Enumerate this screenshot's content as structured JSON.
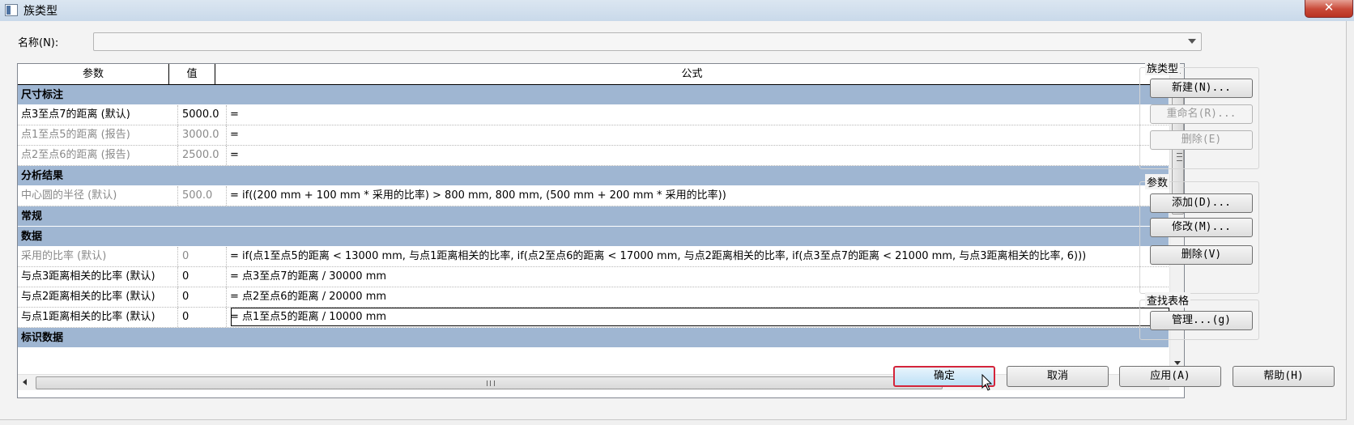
{
  "window": {
    "title": "族类型",
    "close_glyph": "✕"
  },
  "name_field": {
    "label": "名称(N):",
    "value": ""
  },
  "table": {
    "headers": [
      "参数",
      "值",
      "公式"
    ],
    "rows": [
      {
        "type": "group",
        "label": "尺寸标注"
      },
      {
        "type": "param",
        "name": "点3至点7的距离 (默认)",
        "value": "5000.0",
        "formula": "=",
        "dim": false
      },
      {
        "type": "param",
        "name": "点1至点5的距离 (报告)",
        "value": "3000.0",
        "formula": "=",
        "dim": true
      },
      {
        "type": "param",
        "name": "点2至点6的距离 (报告)",
        "value": "2500.0",
        "formula": "=",
        "dim": true
      },
      {
        "type": "group",
        "label": "分析结果"
      },
      {
        "type": "param",
        "name": "中心圆的半径 (默认)",
        "value": "500.0",
        "formula": "= if((200 mm + 100 mm * 采用的比率) > 800 mm, 800 mm, (500 mm + 200 mm * 采用的比率))",
        "dim": true
      },
      {
        "type": "group",
        "label": "常规"
      },
      {
        "type": "group",
        "label": "数据"
      },
      {
        "type": "param",
        "name": "采用的比率 (默认)",
        "value": "0",
        "formula": "= if(点1至点5的距离 < 13000 mm, 与点1距离相关的比率, if(点2至点6的距离 < 17000 mm, 与点2距离相关的比率, if(点3至点7的距离 < 21000 mm, 与点3距离相关的比率, 6)))",
        "dim": true
      },
      {
        "type": "param",
        "name": "与点3距离相关的比率 (默认)",
        "value": "0",
        "formula": "= 点3至点7的距离 / 30000 mm",
        "dim": false
      },
      {
        "type": "param",
        "name": "与点2距离相关的比率 (默认)",
        "value": "0",
        "formula": "= 点2至点6的距离 / 20000 mm",
        "dim": false
      },
      {
        "type": "param",
        "name": "与点1距离相关的比率 (默认)",
        "value": "0",
        "formula": "= 点1至点5的距离 / 10000 mm",
        "dim": false,
        "editing": true
      },
      {
        "type": "group",
        "label": "标识数据"
      }
    ]
  },
  "scrollbars": {
    "h_grip": "III"
  },
  "sidebar": {
    "family_types": {
      "title": "族类型",
      "new": "新建(N)...",
      "rename": "重命名(R)...",
      "delete": "删除(E)"
    },
    "parameters": {
      "title": "参数",
      "add": "添加(D)...",
      "modify": "修改(M)...",
      "delete": "删除(V)"
    },
    "lookup": {
      "title": "查找表格",
      "manage": "管理...(g)"
    }
  },
  "footer": {
    "ok": "确定",
    "cancel": "取消",
    "apply": "应用(A)",
    "help": "帮助(H)"
  }
}
